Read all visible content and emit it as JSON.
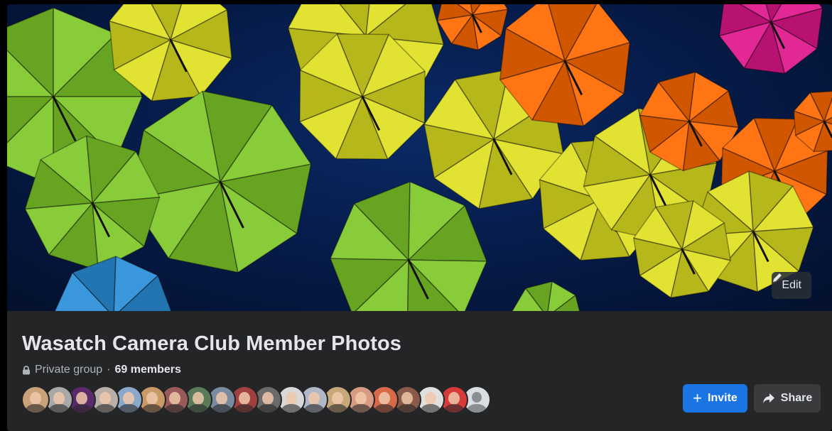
{
  "cover": {
    "edit_label": "Edit",
    "icons": {
      "edit": "pencil-icon"
    },
    "colors": {
      "sky": "#061a46",
      "green": "#7ec82a",
      "yellow": "#dfe020",
      "orange": "#ff6a00",
      "magenta": "#e0168c",
      "blue": "#2a8fd8"
    }
  },
  "group": {
    "name": "Wasatch Camera Club Member Photos",
    "privacy": "Private group",
    "separator": "·",
    "members": "69 members",
    "icons": {
      "privacy": "lock-icon"
    }
  },
  "member_avatars": [
    {
      "name": "member-avatar-1",
      "color": "#c9a27a"
    },
    {
      "name": "member-avatar-2",
      "color": "#a8a8a8"
    },
    {
      "name": "member-avatar-3",
      "color": "#5a2a6a"
    },
    {
      "name": "member-avatar-4",
      "color": "#b8b0a8"
    },
    {
      "name": "member-avatar-5",
      "color": "#8aa8c8"
    },
    {
      "name": "member-avatar-6",
      "color": "#c89a68"
    },
    {
      "name": "member-avatar-7",
      "color": "#9a5a5a"
    },
    {
      "name": "member-avatar-8",
      "color": "#5a7a5a"
    },
    {
      "name": "member-avatar-9",
      "color": "#7a8aa0"
    },
    {
      "name": "member-avatar-10",
      "color": "#a04040"
    },
    {
      "name": "member-avatar-11",
      "color": "#6a6a6a"
    },
    {
      "name": "member-avatar-12",
      "color": "#d8d8d8"
    },
    {
      "name": "member-avatar-13",
      "color": "#b0b8c8"
    },
    {
      "name": "member-avatar-14",
      "color": "#c8a878"
    },
    {
      "name": "member-avatar-15",
      "color": "#d89a80"
    },
    {
      "name": "member-avatar-16",
      "color": "#d86a4a"
    },
    {
      "name": "member-avatar-17",
      "color": "#8a5a4a"
    },
    {
      "name": "member-avatar-18",
      "color": "#e0e0e0"
    },
    {
      "name": "member-avatar-19",
      "color": "#d83a3a"
    },
    {
      "name": "member-avatar-20",
      "color": "#dadde1",
      "default": true
    }
  ],
  "actions": {
    "invite_label": "Invite",
    "share_label": "Share",
    "icons": {
      "invite": "plus-icon",
      "share": "share-arrow-icon"
    },
    "colors": {
      "invite_bg": "#1b74e4",
      "share_bg": "#3a3b3c"
    }
  }
}
